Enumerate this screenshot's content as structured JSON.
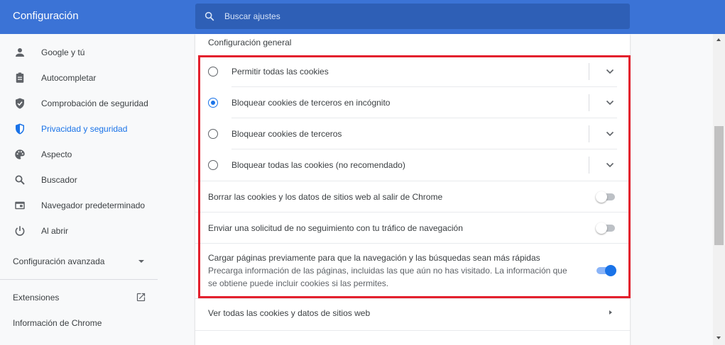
{
  "header": {
    "title": "Configuración",
    "search_placeholder": "Buscar ajustes"
  },
  "sidebar": {
    "items": [
      {
        "label": "Google y tú",
        "icon": "person-icon"
      },
      {
        "label": "Autocompletar",
        "icon": "clipboard-icon"
      },
      {
        "label": "Comprobación de seguridad",
        "icon": "shield-check-icon"
      },
      {
        "label": "Privacidad y seguridad",
        "icon": "shield-icon",
        "active": true
      },
      {
        "label": "Aspecto",
        "icon": "palette-icon"
      },
      {
        "label": "Buscador",
        "icon": "search-icon"
      },
      {
        "label": "Navegador predeterminado",
        "icon": "browser-icon"
      },
      {
        "label": "Al abrir",
        "icon": "power-icon"
      }
    ],
    "advanced": "Configuración avanzada",
    "extensions": "Extensiones",
    "about": "Información de Chrome"
  },
  "main": {
    "section_title": "Configuración general",
    "cookie_options": [
      {
        "label": "Permitir todas las cookies",
        "selected": false
      },
      {
        "label": "Bloquear cookies de terceros en incógnito",
        "selected": true
      },
      {
        "label": "Bloquear cookies de terceros",
        "selected": false
      },
      {
        "label": "Bloquear todas las cookies (no recomendado)",
        "selected": false
      }
    ],
    "toggles": [
      {
        "label": "Borrar las cookies y los datos de sitios web al salir de Chrome",
        "on": false
      },
      {
        "label": "Enviar una solicitud de no seguimiento con tu tráfico de navegación",
        "on": false
      },
      {
        "label": "Cargar páginas previamente para que la navegación y las búsquedas sean más rápidas",
        "description": "Precarga información de las páginas, incluidas las que aún no has visitado. La información que se obtiene puede incluir cookies si las permites.",
        "on": true
      }
    ],
    "see_all": "Ver todas las cookies y datos de sitios web"
  },
  "colors": {
    "header": "#3b73d6",
    "accent": "#1a73e8",
    "highlight_border": "#e3202d"
  }
}
